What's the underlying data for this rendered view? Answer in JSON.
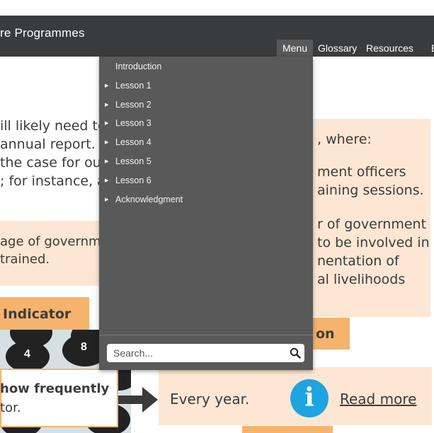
{
  "header": {
    "title": "re Programmes",
    "nav": {
      "menu": "Menu",
      "glossary": "Glossary",
      "resources": "Resources"
    }
  },
  "menu_dropdown": {
    "items": [
      {
        "label": "Introduction",
        "has_arrow": false
      },
      {
        "label": "Lesson 1",
        "has_arrow": true
      },
      {
        "label": "Lesson 2",
        "has_arrow": true
      },
      {
        "label": "Lesson 3",
        "has_arrow": true
      },
      {
        "label": "Lesson 4",
        "has_arrow": true
      },
      {
        "label": "Lesson 5",
        "has_arrow": true
      },
      {
        "label": "Lesson 6",
        "has_arrow": true
      },
      {
        "label": "Acknowledgment",
        "has_arrow": true
      }
    ],
    "search_placeholder": "Search..."
  },
  "content": {
    "left_lines": [
      "ill likely need to",
      "annual report.",
      "the case for out",
      "; for instance, a"
    ],
    "right_intro": ", where:",
    "right_lines_1": [
      "ment officers",
      "aining sessions."
    ],
    "right_lines_2": [
      "r of government",
      "to be involved in",
      "nentation of",
      "al livelihoods"
    ],
    "left_box_lines": [
      "age of governm",
      "trained."
    ],
    "indicator_label": "Indicator",
    "right_orange_label": "on",
    "frequency_lines": [
      "how frequently",
      "tor."
    ],
    "frequency_answer": "Every year.",
    "read_more": "Read more",
    "keypad_keys": [
      "4",
      "8"
    ]
  },
  "colors": {
    "header_bg": "#3a3b3c",
    "dropdown_bg": "#595959",
    "peach": "#fde7d4",
    "orange": "#f6b36d",
    "info_blue": "#1ea4e0"
  },
  "icons": {
    "search": "search-icon",
    "info": "info-icon",
    "arrow": "arrow-right-icon",
    "submenu": "caret-right-icon"
  }
}
